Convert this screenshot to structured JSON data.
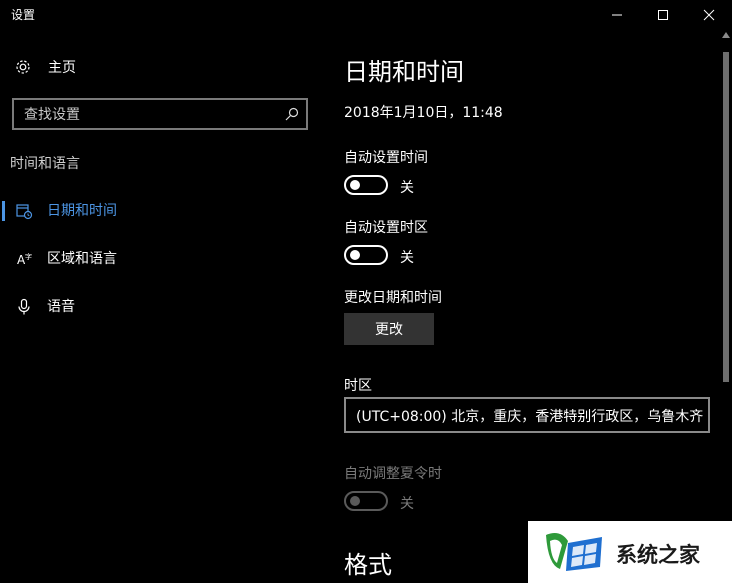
{
  "window": {
    "title": "设置",
    "controls": [
      "minimize-icon",
      "maximize-icon",
      "close-icon"
    ]
  },
  "sidebar": {
    "home_label": "主页",
    "search_placeholder": "查找设置",
    "section_title": "时间和语言",
    "items": [
      {
        "label": "日期和时间",
        "icon": "calendar-clock-icon",
        "active": true
      },
      {
        "label": "区域和语言",
        "icon": "region-language-icon",
        "active": false
      },
      {
        "label": "语音",
        "icon": "microphone-icon",
        "active": false
      }
    ]
  },
  "main": {
    "title": "日期和时间",
    "current_datetime": "2018年1月10日，11:48",
    "auto_time": {
      "label": "自动设置时间",
      "state": "关",
      "on": false
    },
    "auto_timezone": {
      "label": "自动设置时区",
      "state": "关",
      "on": false
    },
    "change_datetime": {
      "label": "更改日期和时间",
      "button": "更改"
    },
    "timezone": {
      "label": "时区",
      "value": "(UTC+08:00) 北京，重庆，香港特别行政区，乌鲁木齐"
    },
    "dst": {
      "label": "自动调整夏令时",
      "state": "关",
      "on": false,
      "disabled": true
    },
    "format_title": "格式"
  },
  "watermark": {
    "text": "系统之家"
  },
  "colors": {
    "accent": "#4c95e4",
    "background": "#000000",
    "button": "#333333"
  }
}
